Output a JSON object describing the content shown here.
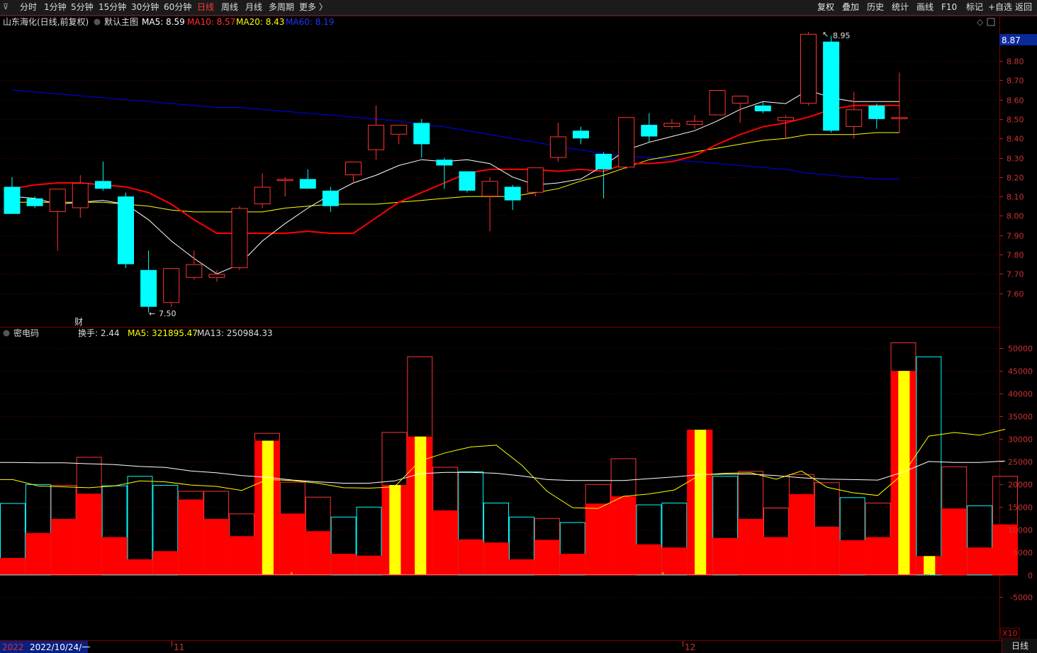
{
  "toolbar": {
    "menu_icon": "menu-icon",
    "left_items": [
      {
        "label": "分时"
      },
      {
        "label": "1分钟"
      },
      {
        "label": "5分钟"
      },
      {
        "label": "15分钟"
      },
      {
        "label": "30分钟"
      },
      {
        "label": "60分钟"
      },
      {
        "label": "日线",
        "active": true
      },
      {
        "label": "周线"
      },
      {
        "label": "月线"
      },
      {
        "label": "多周期"
      },
      {
        "label": "更多 〉"
      }
    ],
    "right_items": [
      {
        "label": "复权"
      },
      {
        "label": "叠加"
      },
      {
        "label": "历史"
      },
      {
        "label": "统计"
      },
      {
        "label": "画线"
      },
      {
        "label": "F10"
      },
      {
        "label": "标记"
      },
      {
        "label": "+自选"
      },
      {
        "label": "返回"
      }
    ]
  },
  "main_panel": {
    "stock_title": "山东海化(日线,前复权)",
    "template": "默认主图",
    "ma5": "MA5: 8.59",
    "ma10": "MA10: 8.57",
    "ma20": "MA20: 8.43",
    "ma60": "MA60: 8.19",
    "current_price": "8.87",
    "high_label": "8.95",
    "low_label": "7.50",
    "fin_marker": "财",
    "axis_ticks": [
      "8.80",
      "8.70",
      "8.60",
      "8.50",
      "8.40",
      "8.30",
      "8.20",
      "8.10",
      "8.00",
      "7.90",
      "7.80",
      "7.70",
      "7.60"
    ]
  },
  "sub_panel": {
    "indicator": "密电码",
    "turnover": "换手: 2.44",
    "ma5": "MA5: 321895.47",
    "ma13": "MA13: 250984.33",
    "axis_ticks": [
      "50000",
      "45000",
      "40000",
      "35000",
      "30000",
      "25000",
      "20000",
      "15000",
      "10000",
      "5000",
      "0",
      "-5000"
    ],
    "scale": "X10"
  },
  "date_axis": {
    "first": "2022/10/24/一",
    "start": "2022",
    "nov": "11",
    "dec": "12"
  },
  "period_tab": "日线",
  "colors": {
    "up": "#ff3333",
    "down": "#00ffff",
    "ma5": "#ffffff",
    "ma10": "#ff0000",
    "ma20": "#ffff00",
    "ma60": "#0000ff",
    "grid": "#5a0000",
    "vol_fill": "#ff0000",
    "vol_mark": "#ffff00"
  },
  "chart_data": {
    "type": "candlestick",
    "price_range": [
      7.5,
      8.95
    ],
    "candles": [
      {
        "o": 8.15,
        "h": 8.2,
        "l": 8.01,
        "c": 8.01
      },
      {
        "o": 8.09,
        "h": 8.1,
        "l": 8.04,
        "c": 8.05
      },
      {
        "o": 8.02,
        "h": 8.14,
        "l": 7.82,
        "c": 8.14
      },
      {
        "o": 8.04,
        "h": 8.21,
        "l": 7.99,
        "c": 8.17
      },
      {
        "o": 8.18,
        "h": 8.28,
        "l": 8.13,
        "c": 8.14
      },
      {
        "o": 8.1,
        "h": 8.12,
        "l": 7.73,
        "c": 7.75
      },
      {
        "o": 7.72,
        "h": 7.82,
        "l": 7.5,
        "c": 7.53
      },
      {
        "o": 7.55,
        "h": 7.72,
        "l": 7.53,
        "c": 7.73
      },
      {
        "o": 7.68,
        "h": 7.82,
        "l": 7.67,
        "c": 7.75
      },
      {
        "o": 7.68,
        "h": 7.72,
        "l": 7.66,
        "c": 7.7
      },
      {
        "o": 7.73,
        "h": 8.05,
        "l": 7.72,
        "c": 8.04
      },
      {
        "o": 8.06,
        "h": 8.22,
        "l": 8.04,
        "c": 8.15
      },
      {
        "o": 8.18,
        "h": 8.2,
        "l": 8.1,
        "c": 8.19
      },
      {
        "o": 8.19,
        "h": 8.24,
        "l": 8.14,
        "c": 8.14
      },
      {
        "o": 8.13,
        "h": 8.15,
        "l": 8.02,
        "c": 8.05
      },
      {
        "o": 8.21,
        "h": 8.28,
        "l": 8.17,
        "c": 8.28
      },
      {
        "o": 8.34,
        "h": 8.57,
        "l": 8.29,
        "c": 8.47
      },
      {
        "o": 8.42,
        "h": 8.47,
        "l": 8.37,
        "c": 8.47
      },
      {
        "o": 8.48,
        "h": 8.5,
        "l": 8.3,
        "c": 8.37
      },
      {
        "o": 8.29,
        "h": 8.3,
        "l": 8.14,
        "c": 8.26
      },
      {
        "o": 8.23,
        "h": 8.23,
        "l": 8.12,
        "c": 8.13
      },
      {
        "o": 8.1,
        "h": 8.2,
        "l": 7.92,
        "c": 8.18
      },
      {
        "o": 8.15,
        "h": 8.16,
        "l": 8.03,
        "c": 8.08
      },
      {
        "o": 8.12,
        "h": 8.25,
        "l": 8.1,
        "c": 8.25
      },
      {
        "o": 8.3,
        "h": 8.48,
        "l": 8.28,
        "c": 8.41
      },
      {
        "o": 8.44,
        "h": 8.46,
        "l": 8.37,
        "c": 8.4
      },
      {
        "o": 8.32,
        "h": 8.33,
        "l": 8.09,
        "c": 8.24
      },
      {
        "o": 8.25,
        "h": 8.51,
        "l": 8.24,
        "c": 8.51
      },
      {
        "o": 8.47,
        "h": 8.53,
        "l": 8.38,
        "c": 8.41
      },
      {
        "o": 8.46,
        "h": 8.5,
        "l": 8.45,
        "c": 8.48
      },
      {
        "o": 8.47,
        "h": 8.52,
        "l": 8.45,
        "c": 8.49
      },
      {
        "o": 8.52,
        "h": 8.65,
        "l": 8.52,
        "c": 8.65
      },
      {
        "o": 8.58,
        "h": 8.6,
        "l": 8.48,
        "c": 8.62
      },
      {
        "o": 8.57,
        "h": 8.59,
        "l": 8.53,
        "c": 8.54
      },
      {
        "o": 8.49,
        "h": 8.52,
        "l": 8.4,
        "c": 8.51
      },
      {
        "o": 8.58,
        "h": 8.95,
        "l": 8.57,
        "c": 8.94
      },
      {
        "o": 8.9,
        "h": 8.93,
        "l": 8.43,
        "c": 8.44
      },
      {
        "o": 8.46,
        "h": 8.64,
        "l": 8.4,
        "c": 8.55
      },
      {
        "o": 8.57,
        "h": 8.58,
        "l": 8.45,
        "c": 8.5
      },
      {
        "o": 8.5,
        "h": 8.74,
        "l": 8.43,
        "c": 8.51
      }
    ],
    "ma5": [
      8.1,
      8.09,
      8.06,
      8.07,
      8.08,
      8.06,
      7.98,
      7.87,
      7.78,
      7.7,
      7.75,
      7.87,
      7.96,
      8.04,
      8.11,
      8.17,
      8.21,
      8.26,
      8.29,
      8.28,
      8.29,
      8.27,
      8.2,
      8.16,
      8.17,
      8.19,
      8.26,
      8.34,
      8.38,
      8.41,
      8.44,
      8.49,
      8.55,
      8.59,
      8.58,
      8.65,
      8.61,
      8.59,
      8.59,
      8.59
    ],
    "ma10": [
      8.14,
      8.16,
      8.17,
      8.17,
      8.16,
      8.15,
      8.12,
      8.06,
      7.98,
      7.91,
      7.91,
      7.91,
      7.91,
      7.92,
      7.91,
      7.91,
      7.99,
      8.07,
      8.12,
      8.17,
      8.22,
      8.24,
      8.24,
      8.24,
      8.23,
      8.24,
      8.23,
      8.27,
      8.27,
      8.28,
      8.31,
      8.37,
      8.42,
      8.46,
      8.48,
      8.51,
      8.55,
      8.57,
      8.57,
      8.57
    ],
    "ma20": [
      8.07,
      8.07,
      8.07,
      8.07,
      8.07,
      8.06,
      8.05,
      8.03,
      8.02,
      8.02,
      8.02,
      8.02,
      8.04,
      8.05,
      8.06,
      8.06,
      8.06,
      8.07,
      8.08,
      8.09,
      8.1,
      8.1,
      8.1,
      8.12,
      8.14,
      8.18,
      8.21,
      8.25,
      8.29,
      8.31,
      8.33,
      8.35,
      8.37,
      8.39,
      8.4,
      8.42,
      8.42,
      8.42,
      8.43,
      8.43
    ],
    "ma60": [
      8.65,
      8.64,
      8.63,
      8.62,
      8.61,
      8.6,
      8.59,
      8.58,
      8.57,
      8.56,
      8.56,
      8.55,
      8.54,
      8.53,
      8.52,
      8.51,
      8.5,
      8.49,
      8.47,
      8.46,
      8.44,
      8.42,
      8.4,
      8.38,
      8.36,
      8.34,
      8.32,
      8.31,
      8.3,
      8.29,
      8.28,
      8.27,
      8.26,
      8.25,
      8.24,
      8.22,
      8.21,
      8.2,
      8.19,
      8.19
    ],
    "volume": [
      {
        "v": 15800,
        "u": false,
        "f": 3700
      },
      {
        "v": 20000,
        "u": false,
        "f": 9200
      },
      {
        "v": 19800,
        "u": true,
        "f": 12300
      },
      {
        "v": 26000,
        "u": true,
        "f": 17900
      },
      {
        "v": 19700,
        "u": false,
        "f": 8300
      },
      {
        "v": 21800,
        "u": false,
        "f": 3400
      },
      {
        "v": 19800,
        "u": false,
        "f": 5200
      },
      {
        "v": 18500,
        "u": true,
        "f": 16600
      },
      {
        "v": 18500,
        "u": true,
        "f": 12300
      },
      {
        "v": 13500,
        "u": true,
        "f": 8500
      },
      {
        "v": 31300,
        "u": true,
        "f": 29600,
        "y": true
      },
      {
        "v": 20500,
        "u": true,
        "f": 13500
      },
      {
        "v": 17200,
        "u": true,
        "f": 9600
      },
      {
        "v": 12800,
        "u": false,
        "f": 4600
      },
      {
        "v": 15000,
        "u": false,
        "f": 4200
      },
      {
        "v": 31500,
        "u": true,
        "f": 19800,
        "y": true
      },
      {
        "v": 48200,
        "u": true,
        "f": 30500,
        "y": true
      },
      {
        "v": 23800,
        "u": true,
        "f": 14200
      },
      {
        "v": 22800,
        "u": false,
        "f": 7800
      },
      {
        "v": 15900,
        "u": false,
        "f": 7100
      },
      {
        "v": 12800,
        "u": false,
        "f": 3400
      },
      {
        "v": 12500,
        "u": true,
        "f": 7700
      },
      {
        "v": 11600,
        "u": false,
        "f": 4600
      },
      {
        "v": 20000,
        "u": true,
        "f": 15700
      },
      {
        "v": 25700,
        "u": true,
        "f": 17300
      },
      {
        "v": 15500,
        "u": false,
        "f": 6700
      },
      {
        "v": 15900,
        "u": false,
        "f": 6000
      },
      {
        "v": 32000,
        "u": true,
        "f": 32000,
        "y": true
      },
      {
        "v": 21800,
        "u": false,
        "f": 8100
      },
      {
        "v": 22900,
        "u": true,
        "f": 12300
      },
      {
        "v": 14800,
        "u": true,
        "f": 8300
      },
      {
        "v": 22200,
        "u": true,
        "f": 17800
      },
      {
        "v": 20400,
        "u": true,
        "f": 10600
      },
      {
        "v": 17100,
        "u": false,
        "f": 7600
      },
      {
        "v": 15900,
        "u": true,
        "f": 8300
      },
      {
        "v": 51300,
        "u": true,
        "f": 45000,
        "y": true
      },
      {
        "v": 48200,
        "u": false,
        "f": 4100,
        "y": true
      },
      {
        "v": 23900,
        "u": true,
        "f": 14600
      },
      {
        "v": 15300,
        "u": false,
        "f": 6000
      },
      {
        "v": 21800,
        "u": true,
        "f": 11100
      }
    ],
    "vol_ma_yellow": [
      21000,
      19600,
      19400,
      19200,
      19600,
      20700,
      20500,
      19800,
      19500,
      18600,
      21000,
      20800,
      20200,
      19200,
      19100,
      19400,
      25100,
      26900,
      28200,
      28600,
      24200,
      18400,
      14800,
      14600,
      17300,
      17800,
      18700,
      22000,
      22400,
      22500,
      21100,
      22900,
      19300,
      18100,
      17500,
      22300,
      30600,
      31400,
      30800,
      32100
    ],
    "vol_ma_white": [
      24800,
      24700,
      24700,
      24500,
      24300,
      23900,
      23700,
      22900,
      22500,
      21900,
      21500,
      20900,
      20500,
      20200,
      20200,
      20700,
      22300,
      22600,
      22600,
      22400,
      21800,
      21000,
      20800,
      20800,
      20800,
      21200,
      21600,
      22100,
      22200,
      22200,
      21900,
      21400,
      21100,
      21000,
      20900,
      22700,
      25000,
      24800,
      24800,
      25100
    ]
  }
}
